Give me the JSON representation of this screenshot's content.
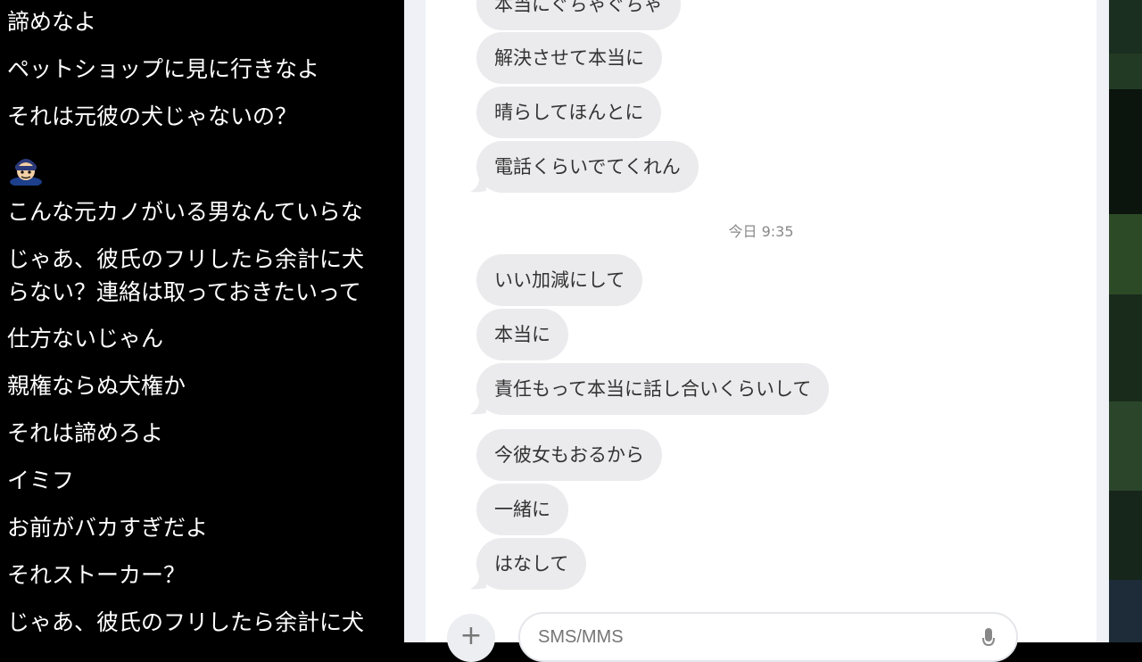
{
  "comments": [
    "諦めなよ",
    "ペットショップに見に行きなよ",
    "それは元彼の犬じゃないの？",
    "こんな元カノがいる男なんていらな",
    "じゃあ、彼氏のフリしたら余計に犬",
    "らない？連絡は取っておきたいって",
    "仕方ないじゃん",
    "親権ならぬ犬権か",
    "それは諦めろよ",
    "イミフ",
    "お前がバカすぎだよ",
    "それストーカー？",
    "じゃあ、彼氏のフリしたら余計に犬"
  ],
  "messages_before": [
    "本当にぐちゃぐちゃ",
    "解決させて本当に",
    "晴らしてほんとに",
    "電話くらいでてくれん"
  ],
  "timestamp": "今日 9:35",
  "messages_after_group1": [
    "いい加減にして",
    "本当に",
    "責任もって本当に話し合いくらいして"
  ],
  "messages_after_group2": [
    "今彼女もおるから",
    "一緒に",
    "はなして"
  ],
  "composer": {
    "placeholder": "SMS/MMS",
    "attach_label": "+"
  }
}
